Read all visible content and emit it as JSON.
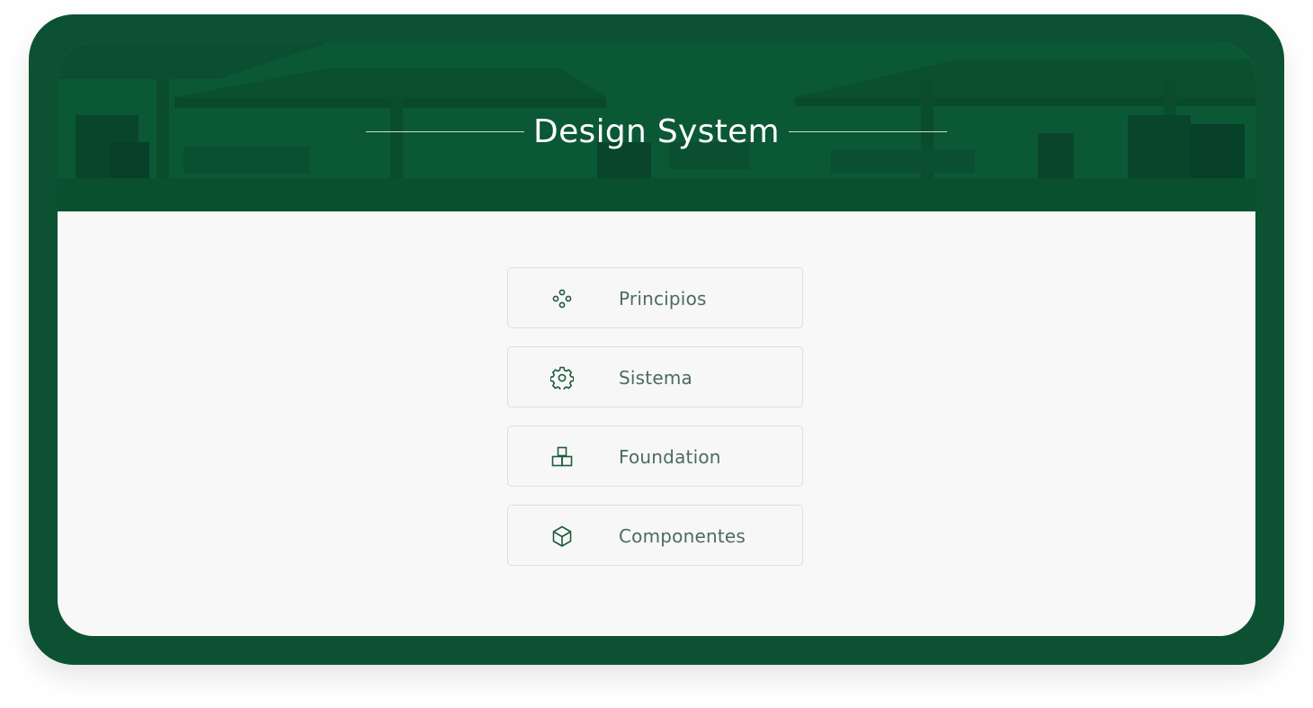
{
  "header": {
    "title": "Design System"
  },
  "menu": {
    "items": [
      {
        "label": "Principios",
        "icon": "principles-icon"
      },
      {
        "label": "Sistema",
        "icon": "gear-icon"
      },
      {
        "label": "Foundation",
        "icon": "blocks-icon"
      },
      {
        "label": "Componentes",
        "icon": "cube-icon"
      }
    ]
  },
  "colors": {
    "frame": "#0c5232",
    "hero": "#0b5834",
    "content_bg": "#f8f8f8",
    "icon": "#1e5a3c",
    "label": "#4e6b5d"
  }
}
